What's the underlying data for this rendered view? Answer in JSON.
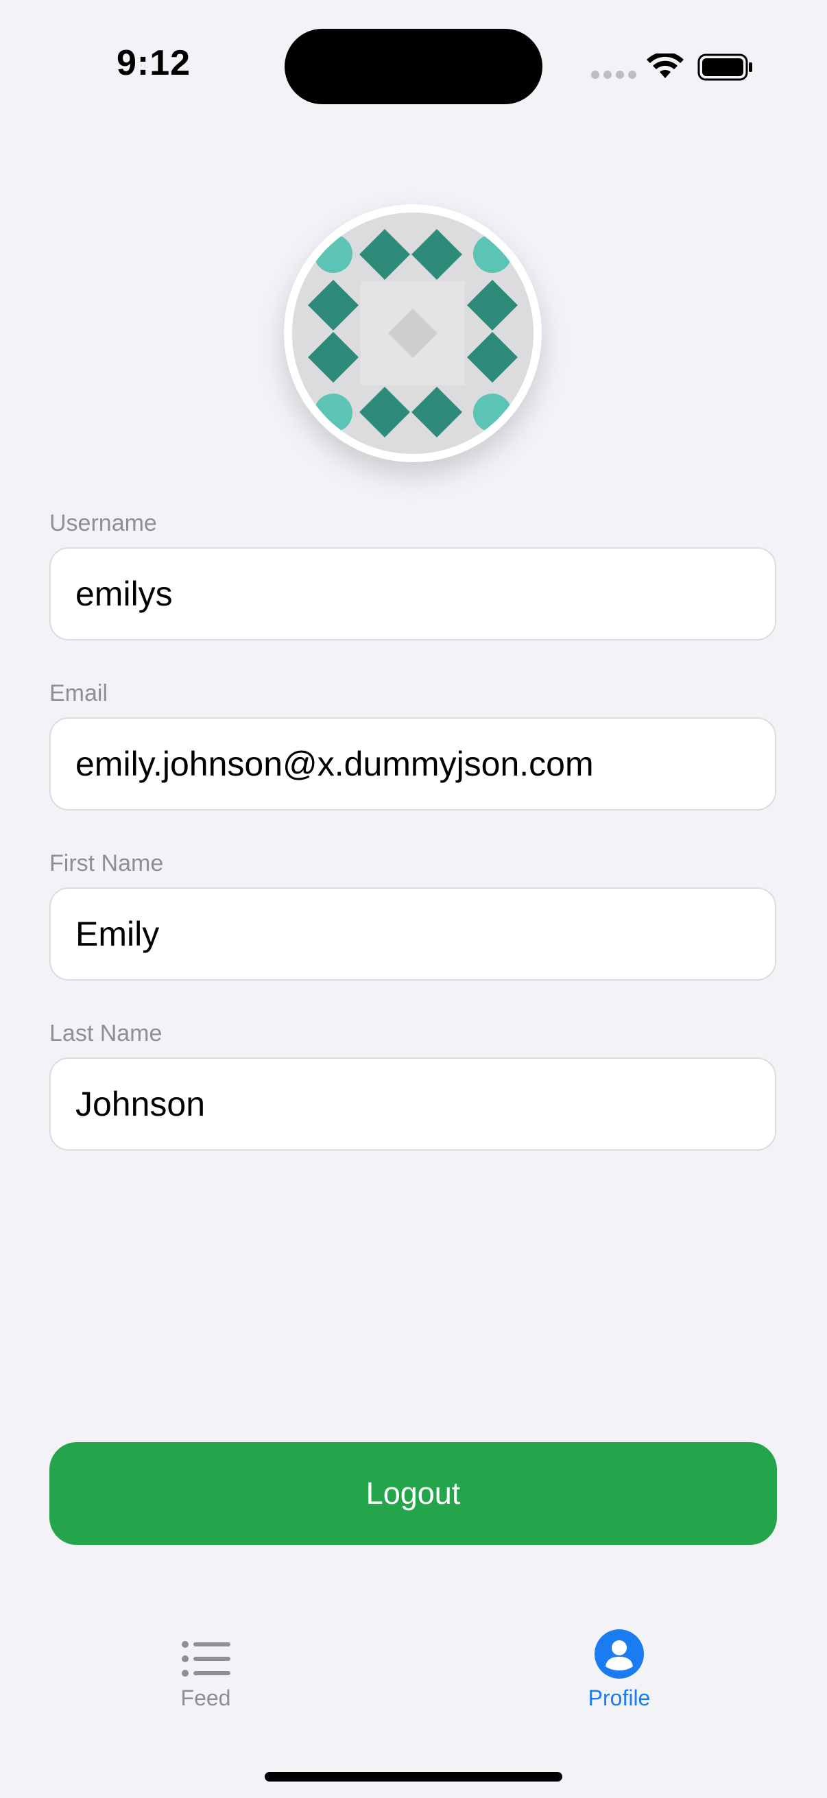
{
  "status_bar": {
    "time": "9:12"
  },
  "profile": {
    "fields": [
      {
        "label": "Username",
        "value": "emilys"
      },
      {
        "label": "Email",
        "value": "emily.johnson@x.dummyjson.com"
      },
      {
        "label": "First Name",
        "value": "Emily"
      },
      {
        "label": "Last Name",
        "value": "Johnson"
      }
    ],
    "logout_label": "Logout"
  },
  "tab_bar": {
    "items": [
      {
        "label": "Feed",
        "icon": "list-icon",
        "selected": false
      },
      {
        "label": "Profile",
        "icon": "person-circle-icon",
        "selected": true
      }
    ],
    "active_color": "#1a7cf0",
    "inactive_color": "#8e8e93"
  },
  "colors": {
    "background": "#f2f2f7",
    "logout": "#25a54b",
    "avatar_pattern": "#2e8b7a"
  }
}
